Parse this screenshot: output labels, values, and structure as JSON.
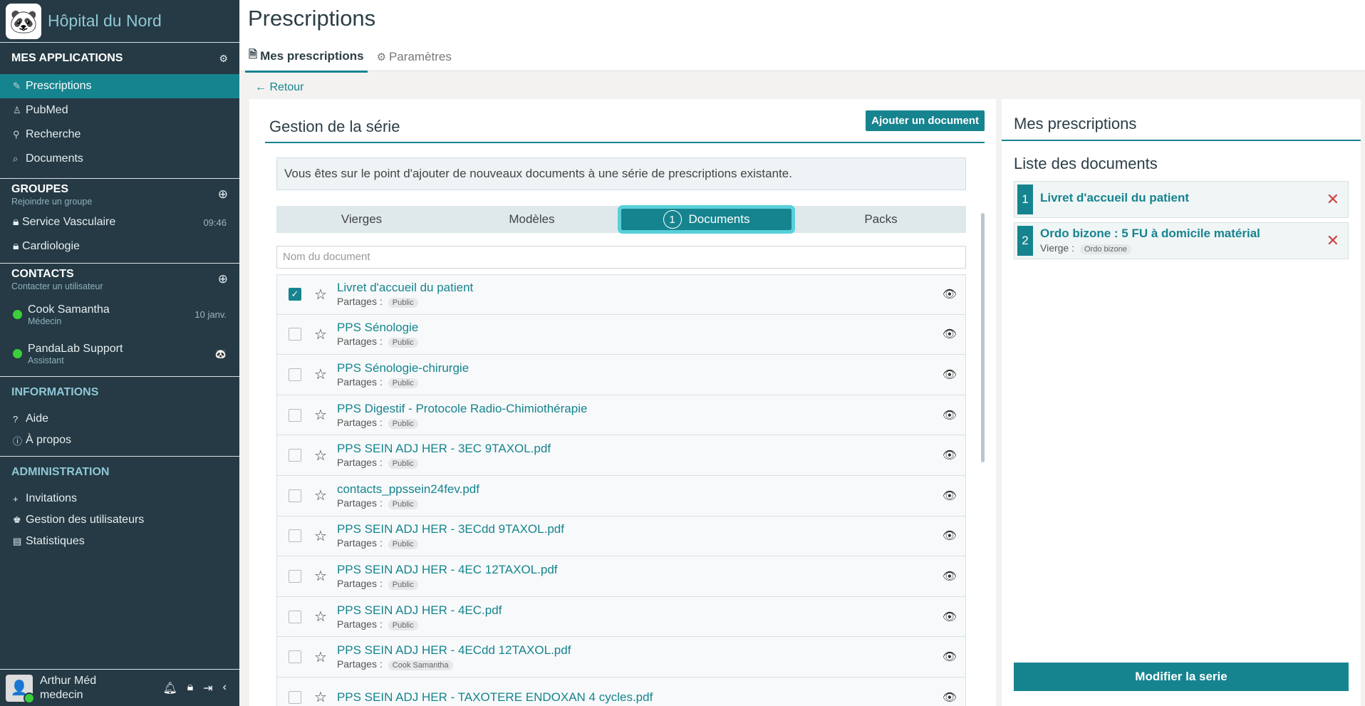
{
  "app": {
    "name": "Hôpital du Nord"
  },
  "sidebar": {
    "apps_title": "MES APPLICATIONS",
    "apps": [
      {
        "label": "Prescriptions",
        "icon": "✎"
      },
      {
        "label": "PubMed",
        "icon": "♙"
      },
      {
        "label": "Recherche",
        "icon": "⚲"
      },
      {
        "label": "Documents",
        "icon": "⌕"
      }
    ],
    "groups_title": "GROUPES",
    "groups_sub": "Rejoindre un groupe",
    "groups": [
      {
        "label": "Service Vasculaire",
        "time": "09:46"
      },
      {
        "label": "Cardiologie",
        "time": ""
      }
    ],
    "contacts_title": "CONTACTS",
    "contacts_sub": "Contacter un utilisateur",
    "contacts": [
      {
        "name": "Cook Samantha",
        "role": "Médecin",
        "meta": "10 janv."
      },
      {
        "name": "PandaLab Support",
        "role": "Assistant",
        "meta": "🐼"
      }
    ],
    "info_title": "INFORMATIONS",
    "info_items": [
      {
        "label": "Aide",
        "icon": "?"
      },
      {
        "label": "À propos",
        "icon": "ⓘ"
      }
    ],
    "admin_title": "ADMINISTRATION",
    "admin_items": [
      {
        "label": "Invitations",
        "icon": "+"
      },
      {
        "label": "Gestion des utilisateurs",
        "icon": "♚"
      },
      {
        "label": "Statistiques",
        "icon": "▤"
      }
    ],
    "user": {
      "name": "Arthur Méd",
      "role": "medecin"
    }
  },
  "header": {
    "title": "Prescriptions",
    "tabs": [
      {
        "label": "Mes prescriptions"
      },
      {
        "label": "Paramètres"
      }
    ]
  },
  "back_label": "Retour",
  "series": {
    "title": "Gestion de la série",
    "add_button": "Ajouter un document",
    "info": "Vous êtes sur le point d'ajouter de nouveaux documents à une série de prescriptions existante.",
    "segments": [
      {
        "label": "Vierges"
      },
      {
        "label": "Modèles"
      },
      {
        "label": "Documents",
        "count": "1"
      },
      {
        "label": "Packs"
      }
    ],
    "search_placeholder": "Nom du document",
    "share_label": "Partages :",
    "documents": [
      {
        "name": "Livret d'accueil du patient",
        "share": "Public",
        "checked": true
      },
      {
        "name": "PPS Sénologie",
        "share": "Public",
        "checked": false
      },
      {
        "name": "PPS Sénologie-chirurgie",
        "share": "Public",
        "checked": false
      },
      {
        "name": "PPS Digestif - Protocole Radio-Chimiothérapie",
        "share": "Public",
        "checked": false
      },
      {
        "name": "PPS SEIN ADJ HER - 3EC 9TAXOL.pdf",
        "share": "Public",
        "checked": false
      },
      {
        "name": "contacts_ppssein24fev.pdf",
        "share": "Public",
        "checked": false
      },
      {
        "name": "PPS SEIN ADJ HER - 3ECdd 9TAXOL.pdf",
        "share": "Public",
        "checked": false
      },
      {
        "name": "PPS SEIN ADJ HER - 4EC 12TAXOL.pdf",
        "share": "Public",
        "checked": false
      },
      {
        "name": "PPS SEIN ADJ HER - 4EC.pdf",
        "share": "Public",
        "checked": false
      },
      {
        "name": "PPS SEIN ADJ HER - 4ECdd 12TAXOL.pdf",
        "share": "Cook Samantha",
        "checked": false
      },
      {
        "name": "PPS SEIN ADJ HER - TAXOTERE ENDOXAN 4 cycles.pdf",
        "share": "",
        "checked": false
      }
    ]
  },
  "right": {
    "title": "Mes prescriptions",
    "subtitle": "Liste des documents",
    "items": [
      {
        "num": "1",
        "name": "Livret d'accueil du patient",
        "meta_label": "",
        "meta_tag": ""
      },
      {
        "num": "2",
        "name": "Ordo bizone : 5 FU à domicile matérial",
        "meta_label": "Vierge :",
        "meta_tag": "Ordo bizone"
      }
    ],
    "modify_button": "Modifier la serie"
  },
  "colors": {
    "accent": "#16848f",
    "sidebar": "#253a44",
    "highlight": "#58d0da",
    "danger": "#d04141"
  }
}
